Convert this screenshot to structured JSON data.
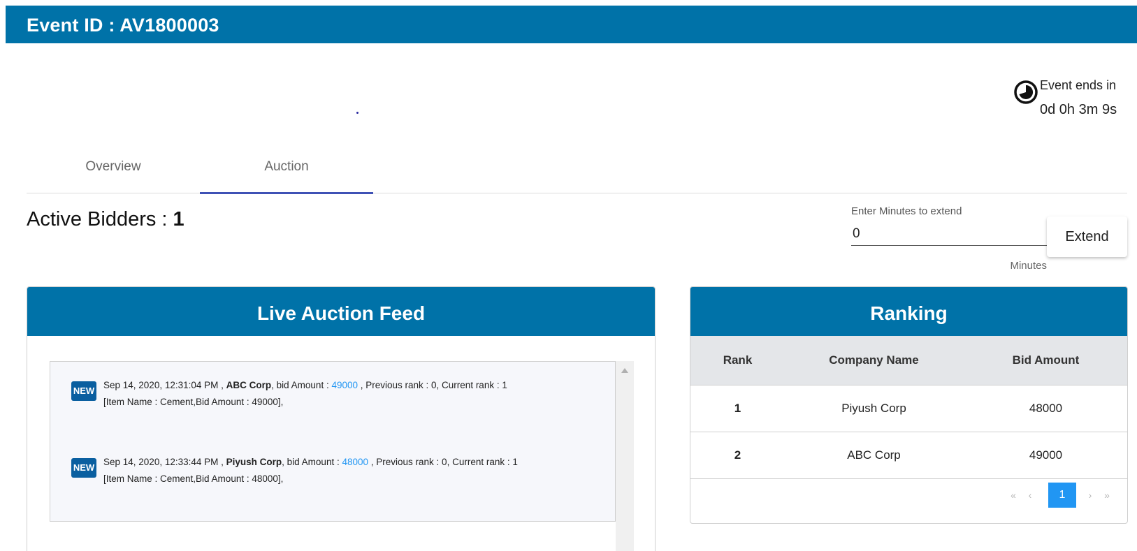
{
  "header": {
    "title": "Event ID : AV1800003"
  },
  "timer": {
    "icon": "clock-icon",
    "label": "Event ends in",
    "value": "0d 0h 3m 9s"
  },
  "tabs": [
    {
      "label": "Overview",
      "active": false
    },
    {
      "label": "Auction",
      "active": true
    }
  ],
  "active_bidders": {
    "label": "Active Bidders : ",
    "count": "1"
  },
  "extend": {
    "label": "Enter Minutes to extend",
    "value": "0",
    "hint": "Minutes",
    "button_label": "Extend"
  },
  "feed": {
    "title": "Live Auction Feed",
    "items": [
      {
        "badge": "NEW",
        "prefix": "Sep 14, 2020, 12:31:04 PM , ",
        "company": "ABC Corp",
        "mid": ", bid Amount : ",
        "amount": "49000",
        "suffix": " , Previous rank : 0, Current rank : 1",
        "detail": "[Item Name : Cement,Bid Amount : 49000],"
      },
      {
        "badge": "NEW",
        "prefix": "Sep 14, 2020, 12:33:44 PM , ",
        "company": "Piyush Corp",
        "mid": ", bid Amount : ",
        "amount": "48000",
        "suffix": " , Previous rank : 0, Current rank : 1",
        "detail": "[Item Name : Cement,Bid Amount : 48000],"
      }
    ]
  },
  "ranking": {
    "title": "Ranking",
    "columns": [
      "Rank",
      "Company Name",
      "Bid Amount"
    ],
    "rows": [
      {
        "rank": "1",
        "company": "Piyush Corp",
        "bid": "48000"
      },
      {
        "rank": "2",
        "company": "ABC Corp",
        "bid": "49000"
      }
    ],
    "pager": {
      "first": "«",
      "prev": "‹",
      "current": "1",
      "next": "›",
      "last": "»"
    }
  },
  "colors": {
    "brand": "#0072a8",
    "tab_underline": "#3f51b5",
    "link": "#2196f3",
    "badge": "#0a5fa0"
  }
}
